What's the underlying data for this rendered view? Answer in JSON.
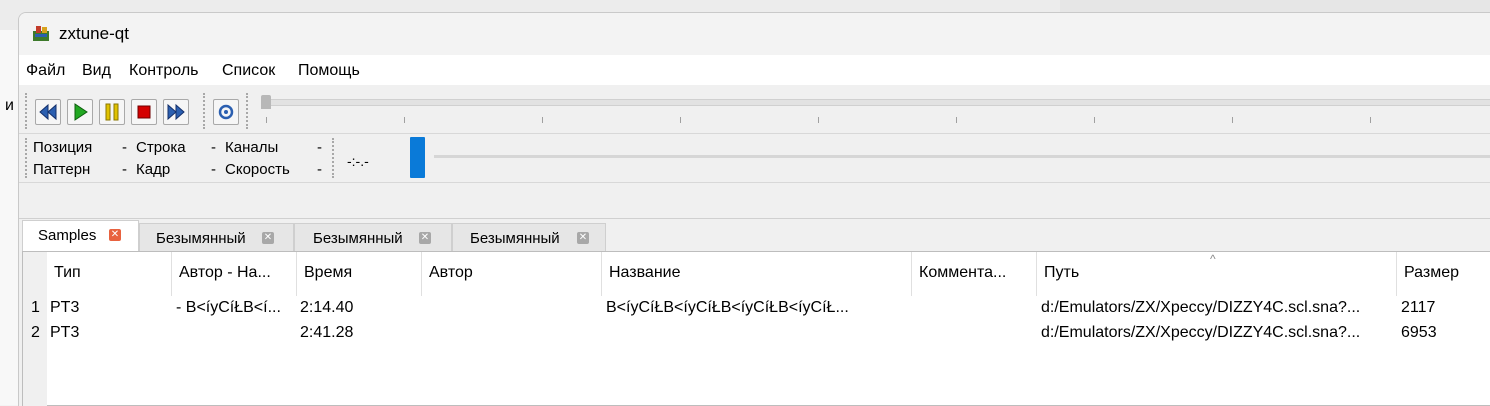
{
  "app": {
    "title": "zxtune-qt"
  },
  "menu": [
    "Файл",
    "Вид",
    "Контроль",
    "Список",
    "Помощь"
  ],
  "background": {
    "letter": "и"
  },
  "toolbar": {
    "buttons": [
      "rewind-icon",
      "play-icon",
      "pause-icon",
      "stop-icon",
      "forward-icon",
      "loop-icon"
    ],
    "colors": {
      "accent": "#0a7ad8",
      "play": "#22a822",
      "pause": "#e0c200",
      "stop": "#d40000"
    }
  },
  "info": {
    "position_label": "Позиция",
    "position_value": "-",
    "pattern_label": "Паттерн",
    "pattern_value": "-",
    "line_label": "Строка",
    "line_value": "-",
    "frame_label": "Кадр",
    "frame_value": "-",
    "channels_label": "Каналы",
    "channels_value": "-",
    "speed_label": "Скорость",
    "speed_value": "-",
    "time": "-:-.-"
  },
  "tabs": [
    {
      "label": "Samples",
      "active": true
    },
    {
      "label": "Безымянный",
      "active": false
    },
    {
      "label": "Безымянный",
      "active": false
    },
    {
      "label": "Безымянный",
      "active": false
    }
  ],
  "table": {
    "columns": [
      "Тип",
      "Автор - На...",
      "Время",
      "Автор",
      "Название",
      "Коммента...",
      "Путь",
      "Размер"
    ],
    "rows": [
      {
        "num": "1",
        "type": "PT3",
        "author_title": "- B<íyCíŁB<í...",
        "time": "2:14.40",
        "author": "",
        "title": "B<íyCíŁB<íyCíŁB<íyCíŁB<íyCíŁ...",
        "comment": "",
        "path": "d:/Emulators/ZX/Xpeccy/DIZZY4C.scl.sna?...",
        "size": "2117"
      },
      {
        "num": "2",
        "type": "PT3",
        "author_title": "",
        "time": "2:41.28",
        "author": "",
        "title": "",
        "comment": "",
        "path": "d:/Emulators/ZX/Xpeccy/DIZZY4C.scl.sna?...",
        "size": "6953"
      }
    ]
  }
}
